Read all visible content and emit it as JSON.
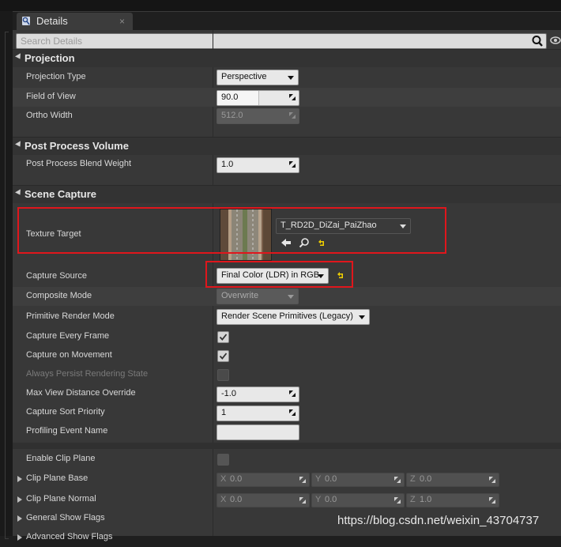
{
  "window": {
    "tab_title": "Details",
    "close_glyph": "×"
  },
  "search": {
    "placeholder": "Search Details"
  },
  "sections": {
    "projection": "Projection",
    "post_process": "Post Process Volume",
    "scene_capture": "Scene Capture"
  },
  "props": {
    "projection_type": {
      "label": "Projection Type",
      "value": "Perspective"
    },
    "field_of_view": {
      "label": "Field of View",
      "value": "90.0",
      "slider_fraction": 0.5
    },
    "ortho_width": {
      "label": "Ortho Width",
      "value": "512.0"
    },
    "blend_weight": {
      "label": "Post Process Blend Weight",
      "value": "1.0"
    },
    "texture_target": {
      "label": "Texture Target",
      "asset": "T_RD2D_DiZai_PaiZhao"
    },
    "capture_source": {
      "label": "Capture Source",
      "value": "Final Color (LDR) in RGB"
    },
    "composite_mode": {
      "label": "Composite Mode",
      "value": "Overwrite"
    },
    "primitive_render_mode": {
      "label": "Primitive Render Mode",
      "value": "Render Scene Primitives (Legacy)"
    },
    "capture_every_frame": {
      "label": "Capture Every Frame",
      "checked": true
    },
    "capture_on_movement": {
      "label": "Capture on Movement",
      "checked": true
    },
    "always_persist": {
      "label": "Always Persist Rendering State",
      "checked": false
    },
    "max_view_distance": {
      "label": "Max View Distance Override",
      "value": "-1.0"
    },
    "capture_sort_priority": {
      "label": "Capture Sort Priority",
      "value": "1"
    },
    "profiling_event_name": {
      "label": "Profiling Event Name",
      "value": ""
    },
    "enable_clip_plane": {
      "label": "Enable Clip Plane",
      "checked": false
    },
    "clip_plane_base": {
      "label": "Clip Plane Base",
      "x": "0.0",
      "y": "0.0",
      "z": "0.0"
    },
    "clip_plane_normal": {
      "label": "Clip Plane Normal",
      "x": "0.0",
      "y": "0.0",
      "z": "1.0"
    },
    "general_show_flags": {
      "label": "General Show Flags"
    },
    "advanced_show_flags": {
      "label": "Advanced Show Flags"
    }
  },
  "axes": {
    "x": "X",
    "y": "Y",
    "z": "Z"
  },
  "watermark": "https://blog.csdn.net/weixin_43704737",
  "colors": {
    "highlight_box": "#e0161c",
    "reset_arrow": "#f0d000"
  }
}
